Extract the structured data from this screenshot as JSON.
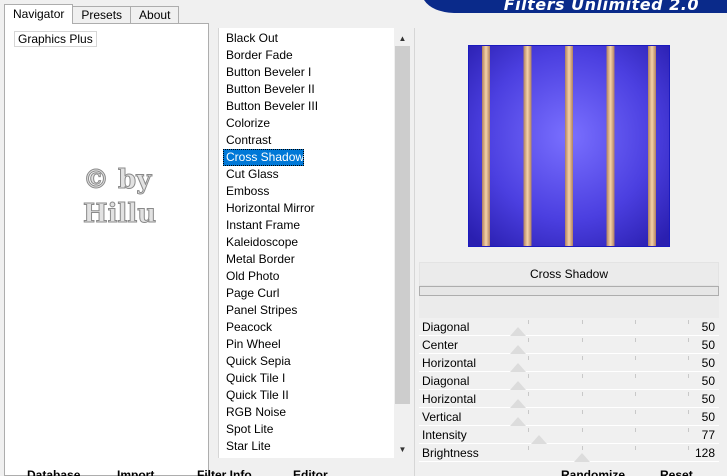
{
  "tabs": [
    {
      "label": "Navigator",
      "active": true
    },
    {
      "label": "Presets",
      "active": false
    },
    {
      "label": "About",
      "active": false
    }
  ],
  "header": {
    "title": "Filters Unlimited 2.0",
    "bg_color": "#0a2a8a"
  },
  "navigator": {
    "category": "Graphics Plus",
    "watermark_line1": "© by",
    "watermark_line2": "Hillu"
  },
  "filter_list": {
    "selected_index": 7,
    "items": [
      "Black Out",
      "Border Fade",
      "Button Beveler I",
      "Button Beveler II",
      "Button Beveler III",
      "Colorize",
      "Contrast",
      "Cross Shadow",
      "Cut Glass",
      "Emboss",
      "Horizontal Mirror",
      "Instant Frame",
      "Kaleidoscope",
      "Metal Border",
      "Old Photo",
      "Page Curl",
      "Panel Stripes",
      "Peacock",
      "Pin Wheel",
      "Quick Sepia",
      "Quick Tile I",
      "Quick Tile II",
      "RGB Noise",
      "Spot Lite",
      "Star Lite"
    ]
  },
  "preview": {
    "bg_color": "#4b3fe0",
    "stripe_color": "#f0c090",
    "stripe_count": 5
  },
  "current_filter": "Cross Shadow",
  "params": [
    {
      "label": "Diagonal",
      "value": "50",
      "fraction": 0.2
    },
    {
      "label": "Center",
      "value": "50",
      "fraction": 0.2
    },
    {
      "label": "Horizontal",
      "value": "50",
      "fraction": 0.2
    },
    {
      "label": "Diagonal",
      "value": "50",
      "fraction": 0.2
    },
    {
      "label": "Horizontal",
      "value": "50",
      "fraction": 0.2
    },
    {
      "label": "Vertical",
      "value": "50",
      "fraction": 0.2
    },
    {
      "label": "Intensity",
      "value": "77",
      "fraction": 0.3
    },
    {
      "label": "Brightness",
      "value": "128",
      "fraction": 0.5
    }
  ],
  "bottom_buttons": {
    "database": "Database",
    "import": "Import",
    "filter_info": "Filter Info",
    "editor": "Editor",
    "randomize": "Randomize",
    "reset": "Reset"
  }
}
